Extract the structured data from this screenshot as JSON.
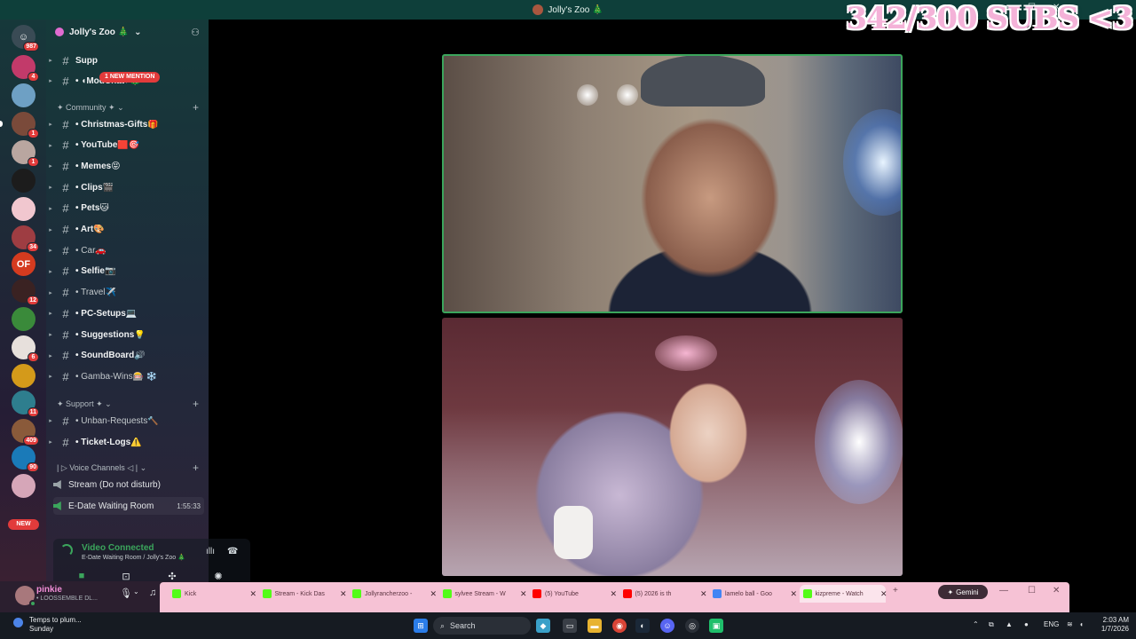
{
  "window": {
    "title": "Jolly's Zoo 🎄",
    "controls": [
      "—",
      "☐",
      "✕"
    ]
  },
  "overlay": {
    "subs_text": "342/300 SUBS <3"
  },
  "rail": {
    "top_badge": "987",
    "servers": [
      {
        "badge": "4",
        "color": "#c23a6a"
      },
      {
        "badge": "",
        "color": "#6ea0c4"
      },
      {
        "badge": "1",
        "color": "#7a4a3a"
      },
      {
        "badge": "1",
        "color": "#b9a6a0"
      },
      {
        "badge": "",
        "color": "#1c1c1c"
      },
      {
        "badge": "",
        "color": "#f1c7cf"
      },
      {
        "badge": "34",
        "color": "#9e3d42"
      },
      {
        "badge": "",
        "color": "#d43b1f",
        "label": "OF"
      },
      {
        "badge": "12",
        "color": "#3a2222"
      },
      {
        "badge": "",
        "color": "#3a8a3a"
      },
      {
        "badge": "6",
        "color": "#e7e0dc"
      },
      {
        "badge": "",
        "color": "#d49a1a"
      },
      {
        "badge": "11",
        "color": "#2e7e8e"
      },
      {
        "badge": "409",
        "color": "#8a5a3a"
      },
      {
        "badge": "90",
        "color": "#1a7ab8"
      },
      {
        "badge": "",
        "color": "#d6a6b8"
      }
    ],
    "new_label": "NEW"
  },
  "guild": {
    "name": "Jolly's Zoo 🎄"
  },
  "mention_badge": "1 NEW MENTION",
  "top_channels": [
    {
      "name": "Supp"
    },
    {
      "name": "• ◖ModChat◗🎄"
    }
  ],
  "categories": {
    "community": "✦ Community ✦ ⌄",
    "support": "✦ Support ✦ ⌄",
    "voice": "| ▷ Voice Channels ◁ | ⌄"
  },
  "community_channels": [
    {
      "name": "• Christmas-Gifts🎁",
      "dim": false
    },
    {
      "name": "• YouTube🟥🎯",
      "dim": false
    },
    {
      "name": "• Memes😝",
      "dim": false
    },
    {
      "name": "• Clips🎬",
      "dim": false
    },
    {
      "name": "• Pets🐱",
      "dim": false
    },
    {
      "name": "• Art🎨",
      "dim": false
    },
    {
      "name": "• Car🚗",
      "dim": true
    },
    {
      "name": "• Selfie📷",
      "dim": false
    },
    {
      "name": "• Travel✈️",
      "dim": true
    },
    {
      "name": "• PC-Setups💻",
      "dim": false
    },
    {
      "name": "• Suggestions💡",
      "dim": false
    },
    {
      "name": "• SoundBoard🔊",
      "dim": false
    },
    {
      "name": "• Gamba-Wins🎰 ❄️",
      "dim": true
    }
  ],
  "support_channels": [
    {
      "name": "• Unban-Requests🔨",
      "dim": true
    },
    {
      "name": "• Ticket-Logs⚠️",
      "dim": false
    }
  ],
  "voice_channels": [
    {
      "name": "Stream (Do not disturb)",
      "time": "",
      "active": false
    },
    {
      "name": "E-Date Waiting Room",
      "time": "1:55:33",
      "active": true
    }
  ],
  "connection": {
    "status": "Video Connected",
    "location": "E-Date Waiting Room / Jolly's Zoo 🎄"
  },
  "user": {
    "name": "pinkie",
    "status": "• LOOSSEMBLE DL..."
  },
  "browser_tabs": [
    {
      "label": "Kick",
      "color": "#53fc18",
      "active": false
    },
    {
      "label": "Stream - Kick Das",
      "color": "#53fc18",
      "active": false
    },
    {
      "label": "Jollyrancherzoo -",
      "color": "#53fc18",
      "active": false
    },
    {
      "label": "sylvee Stream - W",
      "color": "#53fc18",
      "active": false
    },
    {
      "label": "(5) YouTube",
      "color": "#ff0000",
      "active": false
    },
    {
      "label": "(5) 2026 is th",
      "color": "#ff0000",
      "active": false
    },
    {
      "label": "lamelo ball - Goo",
      "color": "#4285f4",
      "active": false
    },
    {
      "label": "kizpreme - Watch",
      "color": "#53fc18",
      "active": true
    }
  ],
  "gemini_label": "Gemini",
  "taskbar": {
    "weather_line1": "Temps to plum...",
    "weather_line2": "Sunday",
    "search_placeholder": "Search",
    "lang": "ENG",
    "time": "2:03 AM",
    "date": "1/7/2026"
  }
}
